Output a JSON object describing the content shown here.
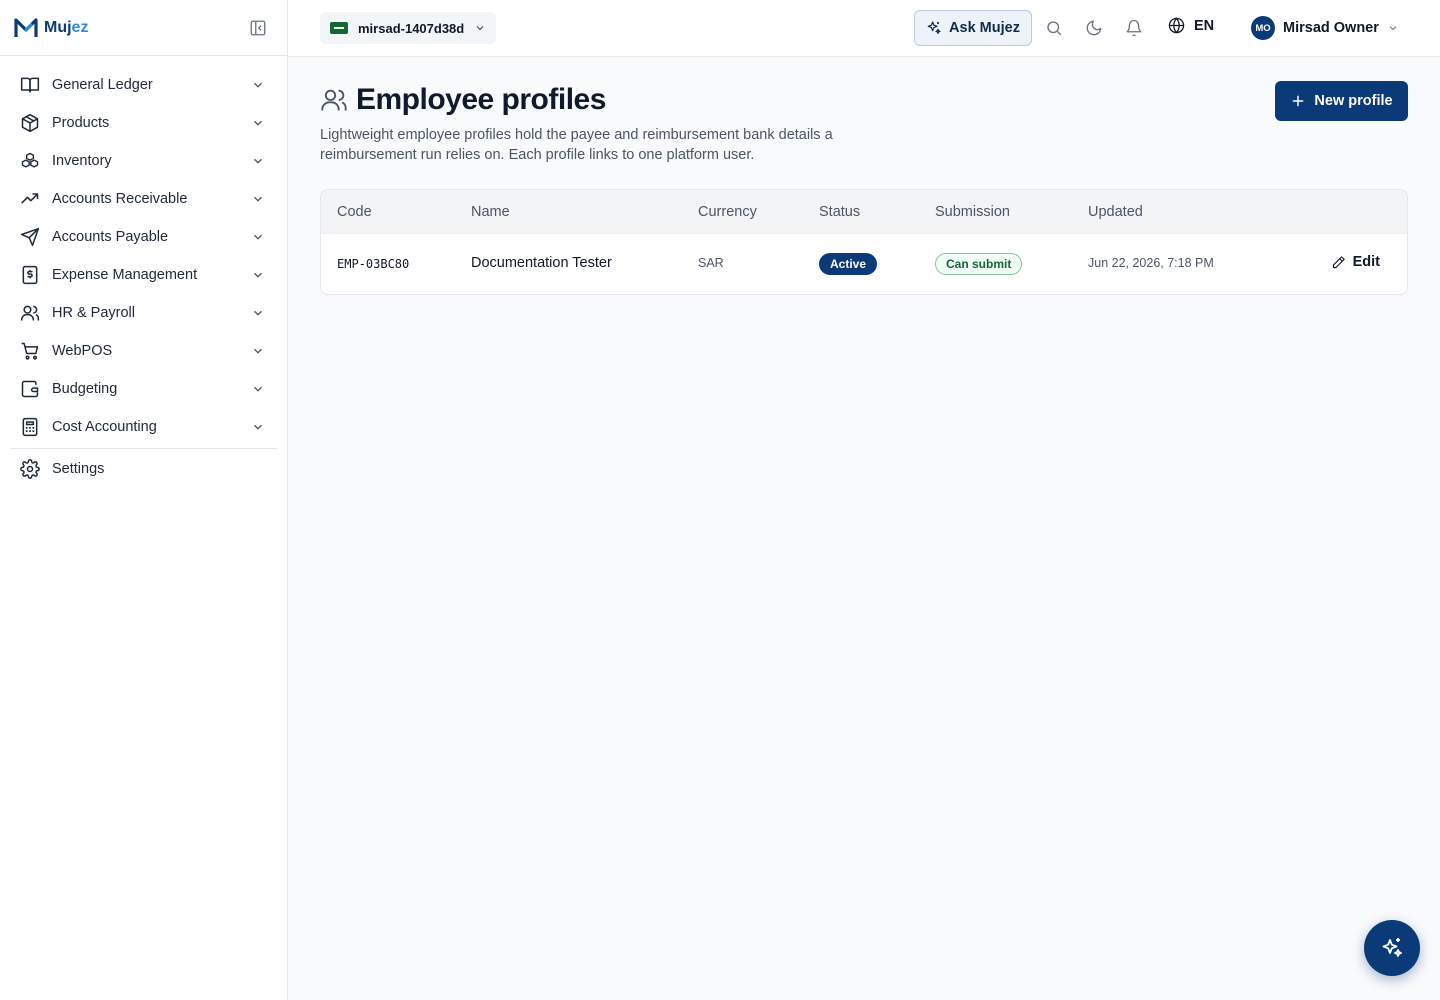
{
  "brand": {
    "name_main": "Muj",
    "name_accent": "ez"
  },
  "sidebar": {
    "items": [
      {
        "label": "General Ledger",
        "icon": "book-open-icon"
      },
      {
        "label": "Products",
        "icon": "package-icon"
      },
      {
        "label": "Inventory",
        "icon": "boxes-icon"
      },
      {
        "label": "Accounts Receivable",
        "icon": "trending-up-icon"
      },
      {
        "label": "Accounts Payable",
        "icon": "send-icon"
      },
      {
        "label": "Expense Management",
        "icon": "receipt-dollar-icon"
      },
      {
        "label": "HR & Payroll",
        "icon": "users-icon"
      },
      {
        "label": "WebPOS",
        "icon": "shopping-cart-icon"
      },
      {
        "label": "Budgeting",
        "icon": "wallet-icon"
      },
      {
        "label": "Cost Accounting",
        "icon": "calculator-icon"
      }
    ],
    "settings_label": "Settings"
  },
  "header": {
    "org_name": "mirsad-1407d38d",
    "ask_label": "Ask Mujez",
    "lang": "EN",
    "user_initials": "MO",
    "user_name": "Mirsad Owner"
  },
  "page": {
    "title": "Employee profiles",
    "description": "Lightweight employee profiles hold the payee and reimbursement bank details a reimbursement run relies on. Each profile links to one platform user.",
    "new_button": "New profile"
  },
  "table": {
    "columns": [
      "Code",
      "Name",
      "Currency",
      "Status",
      "Submission",
      "Updated"
    ],
    "rows": [
      {
        "code": "EMP-03BC80",
        "name": "Documentation Tester",
        "currency": "SAR",
        "status": "Active",
        "submission": "Can submit",
        "updated": "Jun 22, 2026, 7:18 PM",
        "action": "Edit"
      }
    ]
  },
  "colors": {
    "primary": "#0b3a78",
    "accent": "#2b8de0",
    "success": "#166534"
  }
}
